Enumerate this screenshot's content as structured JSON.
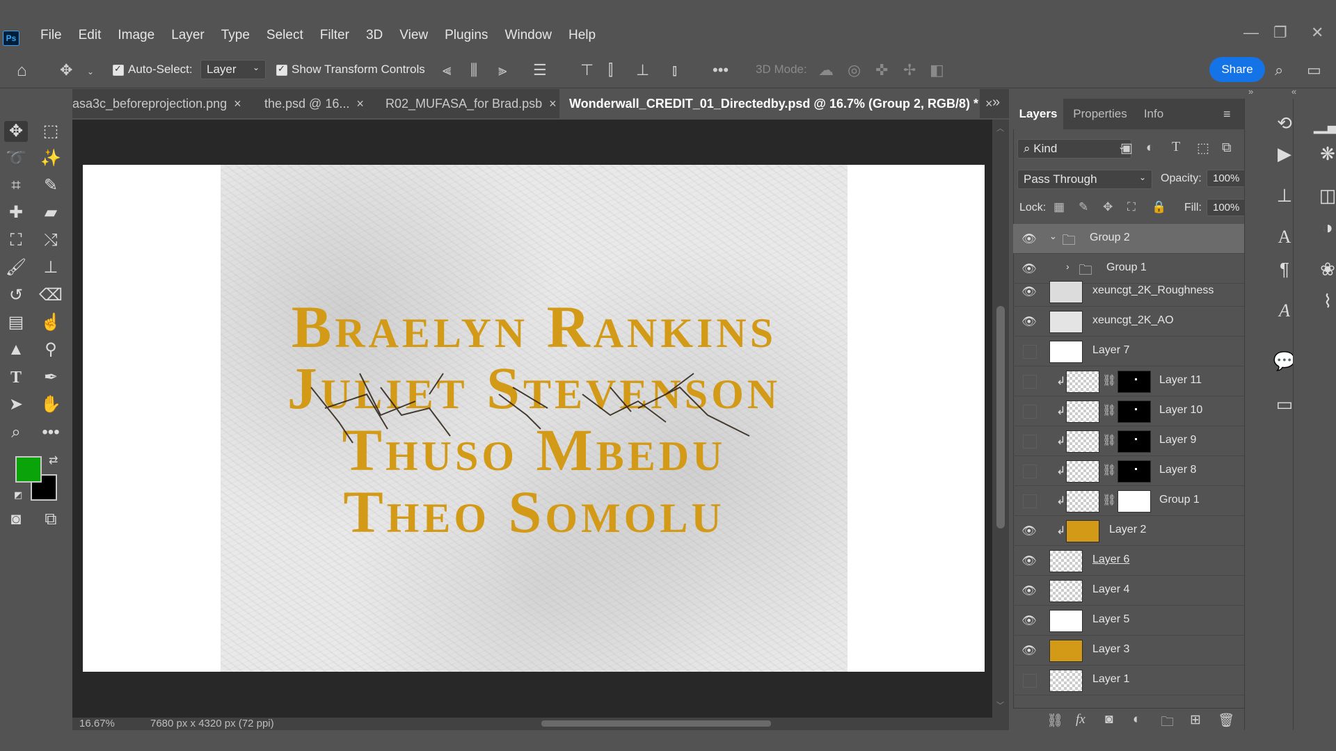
{
  "app": {
    "logo": "Ps"
  },
  "menu": [
    "File",
    "Edit",
    "Image",
    "Layer",
    "Type",
    "Select",
    "Filter",
    "3D",
    "View",
    "Plugins",
    "Window",
    "Help"
  ],
  "options": {
    "auto_select_label": "Auto-Select:",
    "auto_select_value": "Layer",
    "show_transform_label": "Show Transform Controls",
    "three_d_mode_label": "3D Mode:",
    "share_label": "Share"
  },
  "tabs": [
    {
      "label": "asa3c_beforeprojection.png",
      "close": "×"
    },
    {
      "label": "the.psd @ 16...",
      "close": "×"
    },
    {
      "label": "R02_MUFASA_for Brad.psb",
      "close": "×"
    },
    {
      "label": "Wonderwall_CREDIT_01_Directedby.psd @ 16.7% (Group 2, RGB/8) *",
      "close": "×",
      "active": true
    }
  ],
  "canvas": {
    "credits": [
      "Braelyn Rankins",
      "Juliet Stevenson",
      "Thuso Mbedu",
      "Theo Somolu"
    ],
    "text_color": "#d39a17"
  },
  "status": {
    "zoom": "16.67%",
    "doc_size": "7680 px x 4320 px (72 ppi)"
  },
  "panel": {
    "tabs": [
      "Layers",
      "Properties",
      "Info"
    ],
    "filter_kind": "Kind",
    "blend_mode": "Pass Through",
    "opacity_label": "Opacity:",
    "opacity_value": "100%",
    "lock_label": "Lock:",
    "fill_label": "Fill:",
    "fill_value": "100%",
    "layers": [
      {
        "name": "Group 2",
        "visible": true,
        "type": "group",
        "expanded": true
      },
      {
        "name": "Group 1",
        "visible": true,
        "type": "group",
        "expanded": false
      },
      {
        "name": "xeuncgt_2K_Roughness",
        "visible": true,
        "type": "smart"
      },
      {
        "name": "xeuncgt_2K_AO",
        "visible": true,
        "type": "smart"
      },
      {
        "name": "Layer 7",
        "visible": false,
        "type": "white"
      },
      {
        "name": "Layer 11",
        "visible": false,
        "type": "masked"
      },
      {
        "name": "Layer 10",
        "visible": false,
        "type": "masked"
      },
      {
        "name": "Layer 9",
        "visible": false,
        "type": "masked"
      },
      {
        "name": "Layer 8",
        "visible": false,
        "type": "masked"
      },
      {
        "name": "Group 1",
        "visible": false,
        "type": "smart-masked"
      },
      {
        "name": "Layer 2",
        "visible": true,
        "type": "gold-clipped"
      },
      {
        "name": "Layer 6",
        "visible": true,
        "type": "checker"
      },
      {
        "name": "Layer 4",
        "visible": true,
        "type": "checker"
      },
      {
        "name": "Layer 5",
        "visible": true,
        "type": "white"
      },
      {
        "name": "Layer 3",
        "visible": true,
        "type": "gold"
      },
      {
        "name": "Layer 1",
        "visible": false,
        "type": "checker"
      }
    ]
  },
  "colors": {
    "foreground": "#0aa30a",
    "background": "#000000",
    "accent": "#1473e6"
  }
}
